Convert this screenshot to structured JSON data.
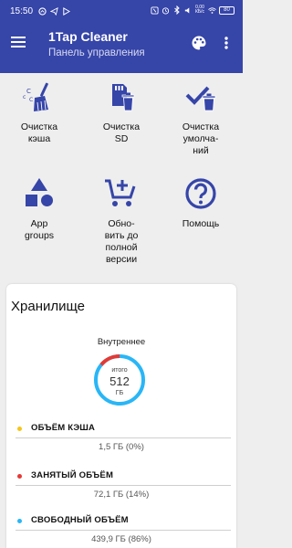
{
  "status_bar": {
    "time": "15:50",
    "net_speed": "0,00\nКБ/с",
    "battery": "80"
  },
  "app_bar": {
    "title": "1Tap Cleaner",
    "subtitle": "Панель управления",
    "background": "#3645a8"
  },
  "grid": [
    {
      "label": "Очистка\nкэша",
      "icon": "broom-cache-icon"
    },
    {
      "label": "Очистка\nSD",
      "icon": "sd-card-clean-icon"
    },
    {
      "label": "Очистка\nумолча-\nний",
      "icon": "check-trash-icon"
    },
    {
      "label": "App\ngroups",
      "icon": "shapes-icon"
    },
    {
      "label": "Обно-\nвить до\nполной\nверсии",
      "icon": "cart-add-icon"
    },
    {
      "label": "Помощь",
      "icon": "help-circle-icon"
    }
  ],
  "storage": {
    "title": "Хранилище",
    "internal_label": "Внутреннее",
    "donut_caption": "итого",
    "total_value": "512",
    "total_unit": "ГБ",
    "segments": [
      {
        "name": "cache",
        "fraction": 0.0,
        "color": "#f5c518"
      },
      {
        "name": "used",
        "fraction": 0.14,
        "color": "#e53935"
      },
      {
        "name": "free",
        "fraction": 0.86,
        "color": "#29b6f6"
      }
    ],
    "legend": [
      {
        "name": "ОБЪЁМ КЭША",
        "value": "1,5 ГБ (0%)",
        "color": "#f5c518"
      },
      {
        "name": "ЗАНЯТЫЙ ОБЪЁМ",
        "value": "72,1 ГБ (14%)",
        "color": "#e53935"
      },
      {
        "name": "СВОБОДНЫЙ ОБЪЁМ",
        "value": "439,9 ГБ (86%)",
        "color": "#29b6f6"
      }
    ]
  },
  "colors": {
    "accent": "#3645a8",
    "icon": "#3645a8"
  }
}
